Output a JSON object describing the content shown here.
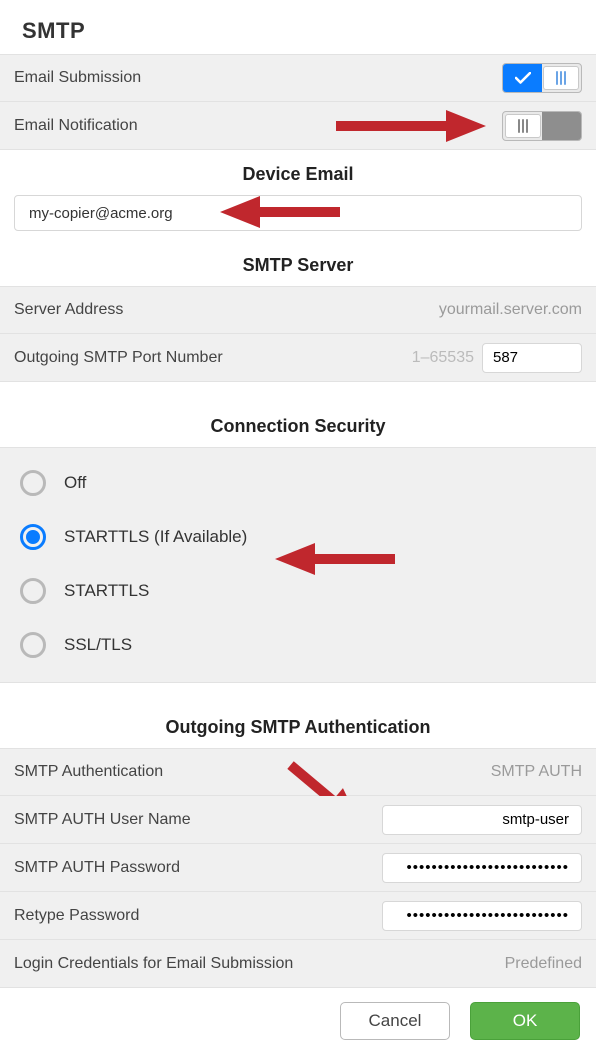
{
  "title": "SMTP",
  "toggles": {
    "email_submission": {
      "label": "Email Submission",
      "on": true
    },
    "email_notification": {
      "label": "Email Notification",
      "on": false
    }
  },
  "device_email": {
    "header": "Device Email",
    "value": "my-copier@acme.org"
  },
  "smtp_server": {
    "header": "SMTP Server",
    "server_address_label": "Server Address",
    "server_address_value": "yourmail.server.com",
    "port_label": "Outgoing SMTP Port Number",
    "port_hint": "1–65535",
    "port_value": "587"
  },
  "connection_security": {
    "header": "Connection Security",
    "options": {
      "off": "Off",
      "starttls_if": "STARTTLS (If Available)",
      "starttls": "STARTTLS",
      "ssltls": "SSL/TLS"
    },
    "selected": "starttls_if"
  },
  "auth": {
    "header": "Outgoing SMTP Authentication",
    "smtp_auth_label": "SMTP Authentication",
    "smtp_auth_value": "SMTP AUTH",
    "username_label": "SMTP AUTH User Name",
    "username_value": "smtp-user",
    "password_label": "SMTP AUTH Password",
    "password_value": "••••••••••••••••••••••••••",
    "retype_label": "Retype Password",
    "retype_value": "••••••••••••••••••••••••••",
    "login_creds_label": "Login Credentials for Email Submission",
    "login_creds_value": "Predefined"
  },
  "footer": {
    "cancel": "Cancel",
    "ok": "OK"
  }
}
